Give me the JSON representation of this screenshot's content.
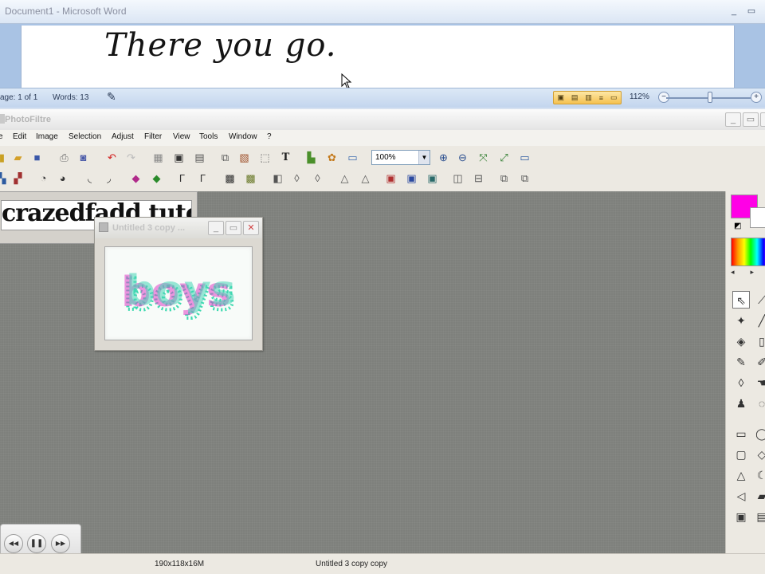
{
  "word": {
    "title_doc": "Document1",
    "title_sep": " - ",
    "title_app": "Microsoft Word",
    "minimize": "_",
    "restore": "▭",
    "handwriting": "There you go.",
    "status_page": "age: 1 of 1",
    "status_words": "Words: 13",
    "zoom": "112%",
    "zoom_minus": "−",
    "zoom_plus": "+"
  },
  "photofiltre": {
    "title": "PhotoFiltre",
    "menu": [
      "e",
      "Edit",
      "Image",
      "Selection",
      "Adjust",
      "Filter",
      "View",
      "Tools",
      "Window",
      "?"
    ],
    "zoom_value": "100%",
    "banner_text": "crazedfadd tutorial",
    "image_window_title": "Untitled 3 copy ...",
    "image_text": "boys",
    "status_size": "190x118x16M",
    "status_doc": "Untitled 3 copy copy",
    "colors": {
      "foreground": "#ff00e6",
      "background": "#ffffff"
    }
  },
  "media": {
    "rewind": "◀◀",
    "pause": "❚❚",
    "forward": "▶▶",
    "volume": "◀)"
  }
}
